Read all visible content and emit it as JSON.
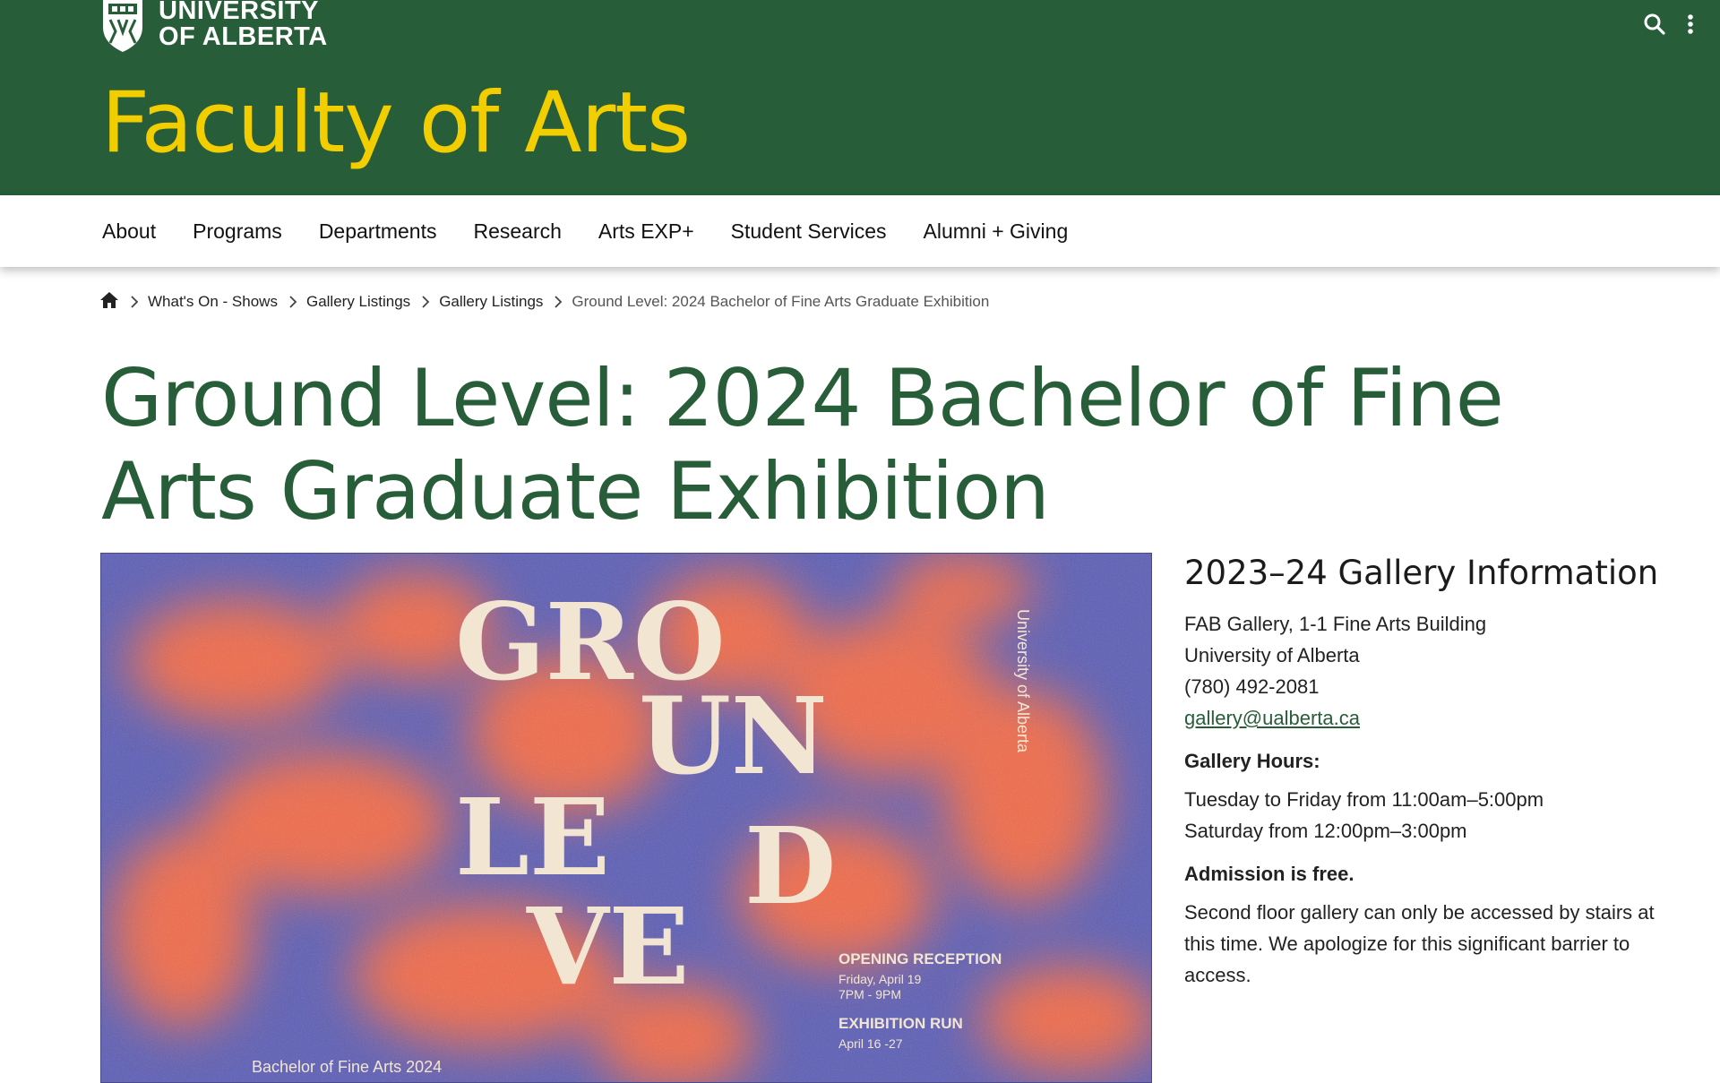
{
  "header": {
    "university_line1": "UNIVERSITY",
    "university_line2": "OF ALBERTA",
    "faculty_title": "Faculty of Arts",
    "search_icon": "search-icon",
    "menu_icon": "vertical-dots-icon"
  },
  "nav": {
    "items": [
      "About",
      "Programs",
      "Departments",
      "Research",
      "Arts EXP+",
      "Student Services",
      "Alumni + Giving"
    ]
  },
  "breadcrumb": {
    "home_icon": "home-icon",
    "items": [
      "What's On - Shows",
      "Gallery Listings",
      "Gallery Listings"
    ],
    "current": "Ground Level: 2024 Bachelor of Fine Arts Graduate Exhibition"
  },
  "page": {
    "title": "Ground Level: 2024 Bachelor of Fine Arts Graduate Exhibition"
  },
  "poster": {
    "letters": [
      "GRO",
      "UN",
      "LE",
      "D",
      "VE"
    ],
    "side_text": "University of Alberta",
    "opening_label": "OPENING RECEPTION",
    "opening_date": "Friday, April 19",
    "opening_time": "7PM - 9PM",
    "run_label": "EXHIBITION RUN",
    "run_dates": "April 16 -27",
    "bottom_text": "Bachelor of Fine Arts 2024",
    "colors": {
      "background": "#5a5cb6",
      "accent": "#ff6a3d",
      "text": "#f2e6d2"
    }
  },
  "gallery_info": {
    "heading": "2023–24 Gallery Information",
    "address_line1": "FAB Gallery, 1-1 Fine Arts Building",
    "address_line2": "University of Alberta",
    "phone": "(780) 492-2081",
    "email": "gallery@ualberta.ca",
    "hours_label": "Gallery Hours:",
    "hours_line1": "Tuesday to Friday from 11:00am–5:00pm",
    "hours_line2": "Saturday from 12:00pm–3:00pm",
    "admission": "Admission is free.",
    "accessibility_note": "Second floor gallery can only be accessed by stairs at this time. We apologize for this significant barrier to access."
  },
  "colors": {
    "brand_green": "#275d38",
    "brand_gold": "#f2cd00"
  }
}
